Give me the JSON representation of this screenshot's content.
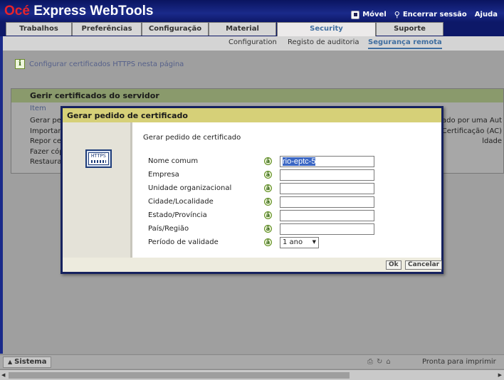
{
  "app": {
    "brand_prefix": "Océ",
    "brand_rest": " Express WebTools"
  },
  "toplinks": {
    "mobile": "Móvel",
    "logout": "Encerrar sessão",
    "help": "Ajuda",
    "icons": [
      "mobile-icon",
      "logout-icon"
    ]
  },
  "tabs": [
    {
      "label": "Trabalhos",
      "active": false
    },
    {
      "label": "Preferências",
      "active": false
    },
    {
      "label": "Configuração",
      "active": false
    },
    {
      "label": "Material",
      "active": false
    },
    {
      "label": "Security",
      "active": true
    },
    {
      "label": "Suporte",
      "active": false
    }
  ],
  "subnav": [
    {
      "label": "Configuration",
      "active": false
    },
    {
      "label": "Registo de auditoria",
      "active": false
    },
    {
      "label": "Segurança remota",
      "active": true
    }
  ],
  "info": {
    "icon": "info-icon",
    "text": "Configurar certificados HTTPS nesta página"
  },
  "panel": {
    "title": "Gerir certificados do servidor",
    "column": "Item",
    "rows": [
      "Gerar pec",
      "Importar",
      "Repor cer",
      "Fazer cóp",
      "Restaurar"
    ],
    "right_texts": [
      "sinado por uma Aut",
      "e Certificação (AC)",
      "ldade"
    ]
  },
  "dialog": {
    "title": "Gerar pedido de certificado",
    "heading": "Gerar pedido de certificado",
    "icon": "https-certificate-icon",
    "icon_text": "HTTPS",
    "fields": [
      {
        "label": "Nome comum",
        "value": "rio-eptc-5",
        "required_icon": "required-icon"
      },
      {
        "label": "Empresa",
        "value": "",
        "required_icon": "required-icon"
      },
      {
        "label": "Unidade organizacional",
        "value": "",
        "required_icon": "required-icon"
      },
      {
        "label": "Cidade/Localidade",
        "value": "",
        "required_icon": "required-icon"
      },
      {
        "label": "Estado/Província",
        "value": "",
        "required_icon": "required-icon"
      },
      {
        "label": "País/Região",
        "value": "",
        "required_icon": "required-icon"
      },
      {
        "label": "Período de validade",
        "value": "1 ano",
        "required_icon": "required-icon"
      }
    ],
    "ok_label": "Ok",
    "cancel_label": "Cancelar"
  },
  "status": {
    "sistema_label": "Sistema",
    "printer_status": "Pronta para imprimir",
    "icons": [
      "printer-icon",
      "refresh-icon",
      "scanner-icon"
    ]
  },
  "colors": {
    "header_bg": "#0d1868",
    "brand_red": "#e8232a",
    "panel_header": "#8a9a6c",
    "dialog_title": "#d6d078",
    "active_tab_text": "#3f6ea0"
  }
}
